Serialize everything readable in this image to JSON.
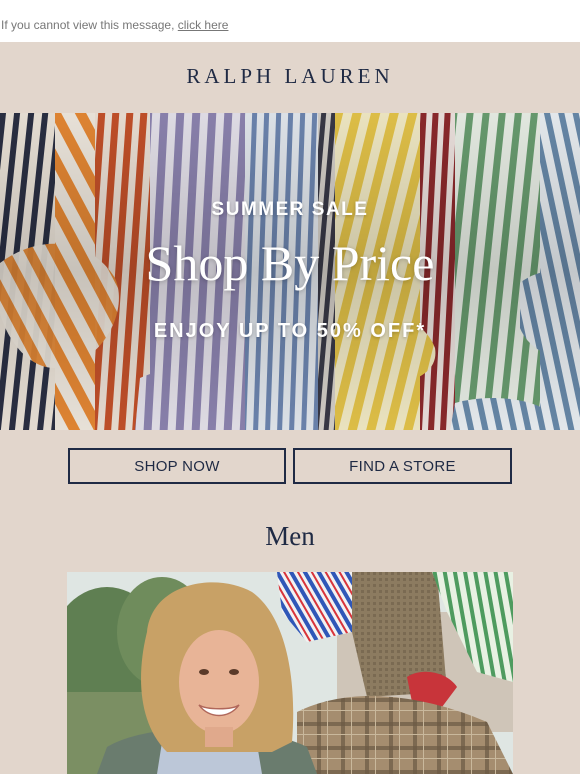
{
  "preheader": {
    "text": "If you cannot view this message, ",
    "link_label": "click here"
  },
  "brand": {
    "logo_text": "RALPH LAUREN"
  },
  "hero": {
    "kicker": "SUMMER SALE",
    "title": "Shop By Price",
    "subtitle": "ENJOY UP TO 50% OFF*"
  },
  "buttons": {
    "shop_now": "SHOP NOW",
    "find_store": "FIND A STORE"
  },
  "section": {
    "title": "Men"
  },
  "colors": {
    "background": "#e2d6cc",
    "navy": "#1f2a44",
    "preheader_text": "#777777"
  }
}
